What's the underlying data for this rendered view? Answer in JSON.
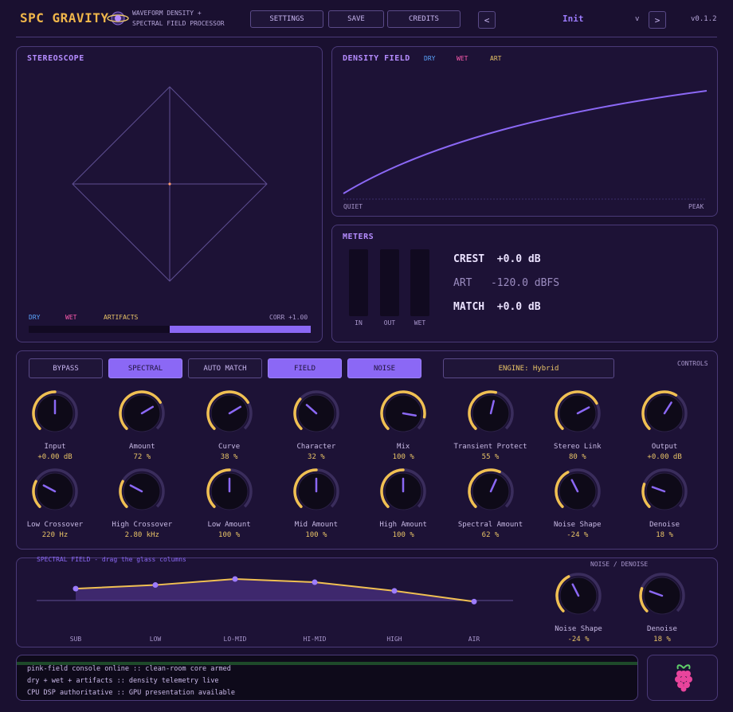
{
  "header": {
    "title": "SPC GRAVITY",
    "subtitle_line1": "WAVEFORM DENSITY +",
    "subtitle_line2": "SPECTRAL FIELD PROCESSOR",
    "settings_label": "SETTINGS",
    "save_label": "SAVE",
    "credits_label": "CREDITS",
    "prev_label": "<",
    "preset_name": "Init",
    "preset_dropdown": "v",
    "next_label": ">",
    "version": "v0.1.2"
  },
  "stereoscope": {
    "title": "STEREOSCOPE",
    "legend_dry": "DRY",
    "legend_wet": "WET",
    "legend_artifacts": "ARTIFACTS",
    "corr": "CORR +1.00",
    "corr_value": 1.0
  },
  "density": {
    "title": "DENSITY FIELD",
    "legend_dry": "DRY",
    "legend_wet": "WET",
    "legend_art": "ART",
    "quiet_label": "QUIET",
    "peak_label": "PEAK"
  },
  "meters": {
    "title": "METERS",
    "in_label": "IN",
    "out_label": "OUT",
    "wet_label": "WET",
    "crest_line": "CREST  +0.0 dB",
    "art_line": "ART   -120.0 dBFS",
    "match_line": "MATCH  +0.0 dB"
  },
  "controls": {
    "title": "CONTROLS",
    "bypass": "BYPASS",
    "spectral": "SPECTRAL",
    "auto_match": "AUTO MATCH",
    "field": "FIELD",
    "noise": "NOISE",
    "engine": "ENGINE:  Hybrid",
    "knobs_row1": [
      {
        "label": "Input",
        "value": "+0.00 dB",
        "pos": 0.5
      },
      {
        "label": "Amount",
        "value": "72 %",
        "pos": 0.72
      },
      {
        "label": "Curve",
        "value": "38 %",
        "pos": 0.72
      },
      {
        "label": "Character",
        "value": "32 %",
        "pos": 0.32
      },
      {
        "label": "Mix",
        "value": "100 %",
        "pos": 0.87
      },
      {
        "label": "Transient Protect",
        "value": "55 %",
        "pos": 0.55
      },
      {
        "label": "Stereo Link",
        "value": "80 %",
        "pos": 0.73
      },
      {
        "label": "Output",
        "value": "+0.00 dB",
        "pos": 0.62
      }
    ],
    "knobs_row2": [
      {
        "label": "Low Crossover",
        "value": "220 Hz",
        "pos": 0.27
      },
      {
        "label": "High Crossover",
        "value": "2.80 kHz",
        "pos": 0.27
      },
      {
        "label": "Low Amount",
        "value": "100 %",
        "pos": 0.5
      },
      {
        "label": "Mid Amount",
        "value": "100 %",
        "pos": 0.5
      },
      {
        "label": "High Amount",
        "value": "100 %",
        "pos": 0.5
      },
      {
        "label": "Spectral Amount",
        "value": "62 %",
        "pos": 0.59
      },
      {
        "label": "Noise Shape",
        "value": "-24 %",
        "pos": 0.4
      },
      {
        "label": "Denoise",
        "value": "18 %",
        "pos": 0.24
      }
    ]
  },
  "spectral_field": {
    "title": "SPECTRAL FIELD - drag the glass columns",
    "bands": [
      "SUB",
      "LOW",
      "LO-MID",
      "HI-MID",
      "HIGH",
      "AIR"
    ],
    "band_levels": [
      0.55,
      0.72,
      1.0,
      0.85,
      0.45,
      -0.05
    ],
    "noise_title": "NOISE / DENOISE",
    "knobs": [
      {
        "label": "Noise Shape",
        "value": "-24 %",
        "pos": 0.4
      },
      {
        "label": "Denoise",
        "value": "18 %",
        "pos": 0.24
      }
    ]
  },
  "console": {
    "line1": "pink-field console online :: clean-room core armed",
    "line2": "dry + wet + artifacts :: density telemetry live",
    "line3": "CPU DSP authoritative :: GPU presentation available"
  },
  "colors": {
    "accent": "#8b68f5",
    "gold": "#e9c467",
    "bg": "#1a1030"
  }
}
